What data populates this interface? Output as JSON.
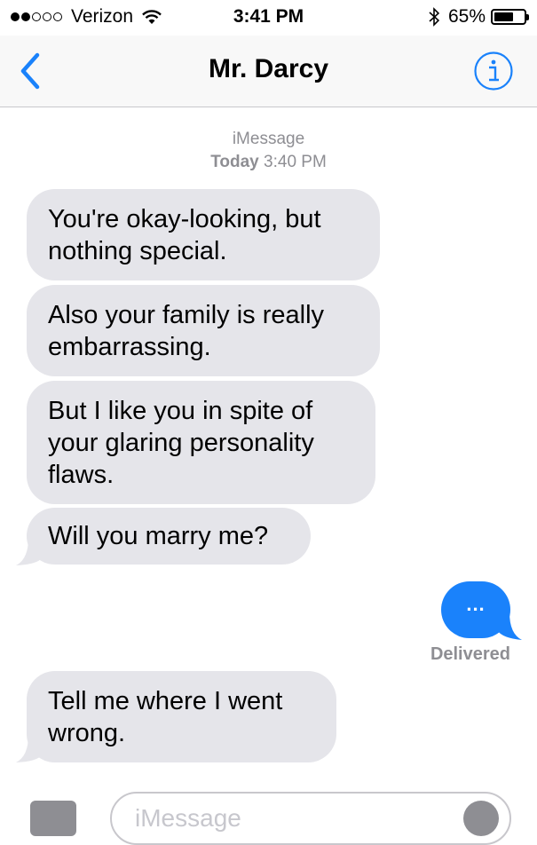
{
  "status_bar": {
    "carrier": "Verizon",
    "signal_bars_filled": 2,
    "signal_bars_total": 5,
    "time": "3:41 PM",
    "battery_percent": "65%",
    "battery_level": 0.65
  },
  "nav": {
    "title": "Mr. Darcy",
    "back_icon": "chevron-left-icon",
    "info_icon": "info-icon",
    "accent_color": "#1a82fb"
  },
  "thread_header": {
    "service": "iMessage",
    "day": "Today",
    "time": "3:40 PM"
  },
  "messages": [
    {
      "direction": "received",
      "text": "You're okay-looking, but\nnothing special."
    },
    {
      "direction": "received",
      "text": "Also your family is really\nembarrassing."
    },
    {
      "direction": "received",
      "text": "But I like you in spite of\nyour glaring personality\nflaws."
    },
    {
      "direction": "received",
      "text": "Will you marry me?"
    },
    {
      "direction": "sent",
      "text": "..."
    },
    {
      "direction": "received",
      "text": "Tell me where I went\nwrong."
    }
  ],
  "delivery_status": "Delivered",
  "composer": {
    "placeholder": "iMessage",
    "camera_icon": "camera-icon",
    "mic_icon": "microphone-icon"
  },
  "colors": {
    "received_bubble": "#e5e5ea",
    "sent_bubble": "#1a82fb",
    "meta_text": "#8e8e93"
  }
}
